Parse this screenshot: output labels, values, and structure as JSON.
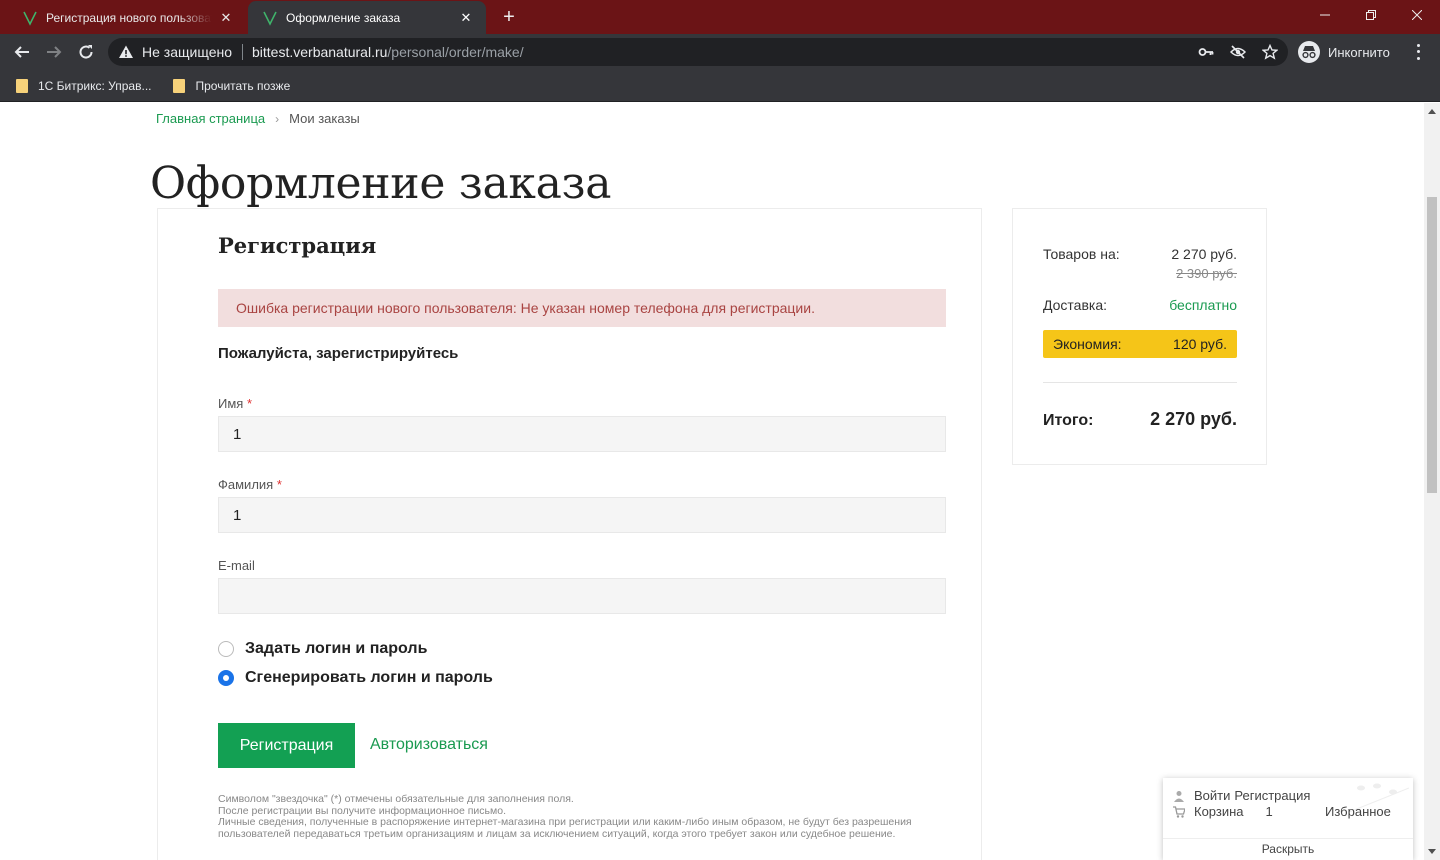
{
  "browser": {
    "tabs": [
      {
        "title": "Регистрация нового пользовате",
        "active": false
      },
      {
        "title": "Оформление заказа",
        "active": true
      }
    ],
    "omnibox": {
      "status": "Не защищено",
      "host": "bittest.verbanatural.ru",
      "path": "/personal/order/make/"
    },
    "incognito_label": "Инкогнито",
    "bookmarks": [
      {
        "label": "1С Битрикс: Управ..."
      },
      {
        "label": "Прочитать позже"
      }
    ],
    "colors": {
      "tabstrip": "#6b1416",
      "toolbar": "#35363a",
      "omnibox": "#202124"
    }
  },
  "breadcrumb": {
    "home": "Главная страница",
    "separator": "›",
    "current": "Мои заказы"
  },
  "page_title": "Оформление заказа",
  "form": {
    "title": "Регистрация",
    "error": "Ошибка регистрации нового пользователя: Не указан номер телефона для регистрации.",
    "subheading": "Пожалуйста, зарегистрируйтесь",
    "required_mark": "*",
    "fields": {
      "first_name": {
        "label": "Имя",
        "value": "1",
        "required": true
      },
      "last_name": {
        "label": "Фамилия",
        "value": "1",
        "required": true
      },
      "email": {
        "label": "E-mail",
        "value": "",
        "required": false
      }
    },
    "radios": [
      {
        "label": "Задать логин и пароль",
        "checked": false
      },
      {
        "label": "Сгенерировать логин и пароль",
        "checked": true
      }
    ],
    "register_button": "Регистрация",
    "login_link": "Авторизоваться",
    "footnote": [
      "Символом \"звездочка\" (*) отмечены обязательные для заполнения поля.",
      "После регистрации вы получите информационное письмо.",
      "Личные сведения, полученные в распоряжение интернет-магазина при регистрации или каким-либо иным образом, не будут без разрешения пользователей передаваться третьим организациям и лицам за исключением ситуаций, когда этого требует закон или судебное решение."
    ]
  },
  "summary": {
    "goods_label": "Товаров на:",
    "goods_value": "2 270 руб.",
    "goods_old_value": "2 390 руб.",
    "delivery_label": "Доставка:",
    "delivery_value": "бесплатно",
    "economy_label": "Экономия:",
    "economy_value": "120 руб.",
    "total_label": "Итого:",
    "total_value": "2 270 руб."
  },
  "widget": {
    "login": "Войти",
    "register": "Регистрация",
    "cart_label": "Корзина",
    "cart_count": "1",
    "favorites": "Избранное",
    "expand": "Раскрыть"
  },
  "colors": {
    "accent_green": "#13a053",
    "error_bg": "#f2dede",
    "error_text": "#a94442",
    "economy_bg": "#f5c518",
    "radio_checked": "#1a73e8"
  }
}
